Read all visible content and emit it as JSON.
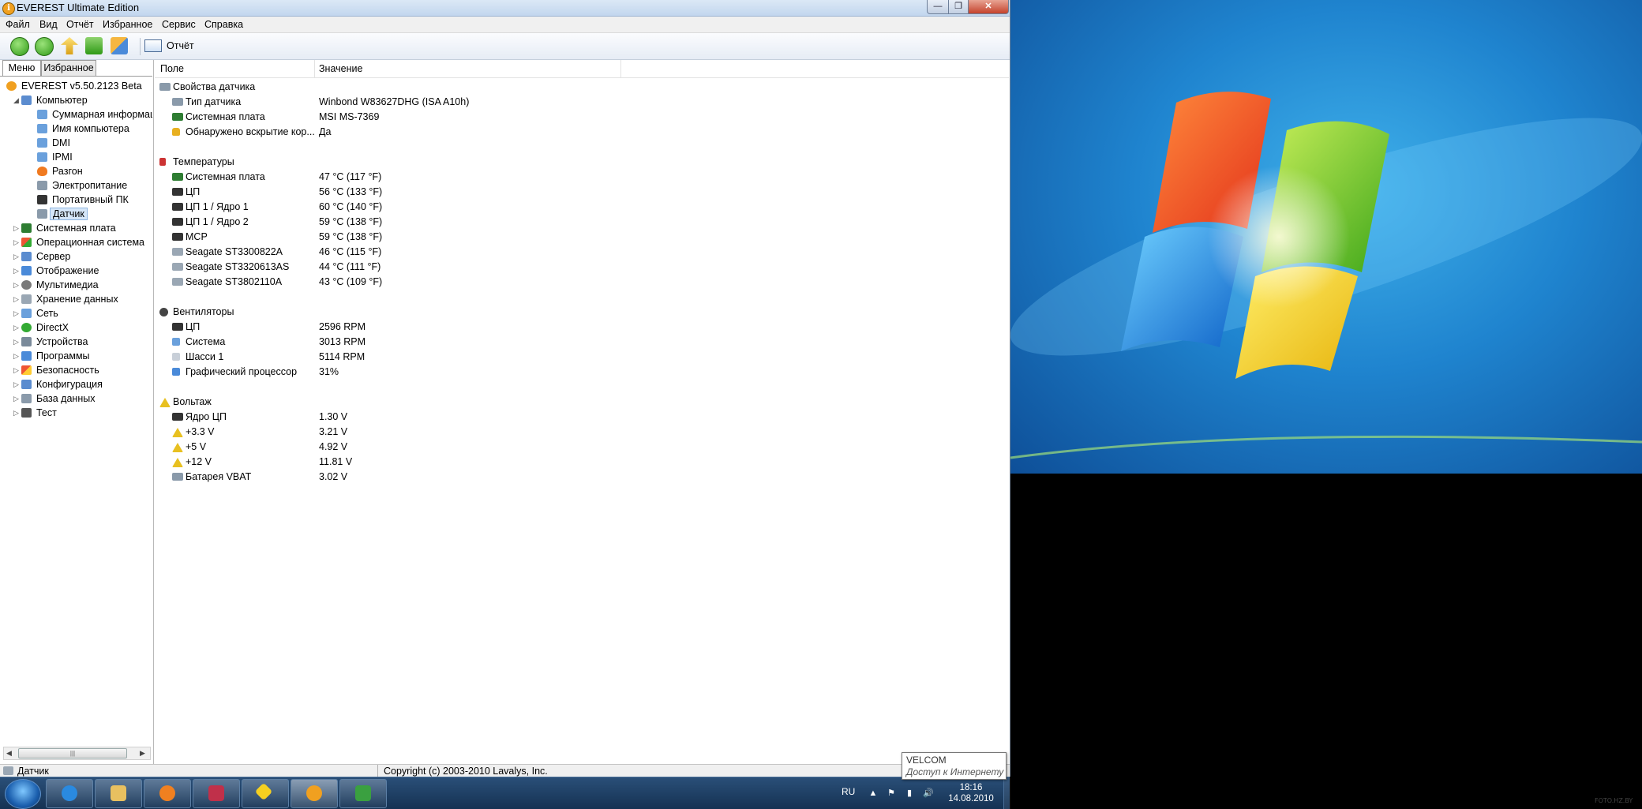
{
  "window": {
    "title": "EVEREST Ultimate Edition",
    "controls": {
      "minimize": "—",
      "maximize": "❐",
      "close": "✕"
    }
  },
  "menubar": [
    "Файл",
    "Вид",
    "Отчёт",
    "Избранное",
    "Сервис",
    "Справка"
  ],
  "toolbar": {
    "report_label": "Отчёт"
  },
  "left_panel": {
    "tabs": [
      "Меню",
      "Избранное"
    ],
    "tree": {
      "root": "EVEREST v5.50.2123 Beta",
      "computer": "Компьютер",
      "computer_children": [
        "Суммарная информация",
        "Имя компьютера",
        "DMI",
        "IPMI",
        "Разгон",
        "Электропитание",
        "Портативный ПК",
        "Датчик"
      ],
      "categories": [
        "Системная плата",
        "Операционная система",
        "Сервер",
        "Отображение",
        "Мультимедиа",
        "Хранение данных",
        "Сеть",
        "DirectX",
        "Устройства",
        "Программы",
        "Безопасность",
        "Конфигурация",
        "База данных",
        "Тест"
      ]
    },
    "scroll_thumb": "|||"
  },
  "table": {
    "headers": {
      "field": "Поле",
      "value": "Значение"
    },
    "groups": {
      "sensor_props": {
        "title": "Свойства датчика",
        "rows": [
          {
            "field": "Тип датчика",
            "value": "Winbond W83627DHG  (ISA A10h)"
          },
          {
            "field": "Системная плата",
            "value": "MSI MS-7369"
          },
          {
            "field": "Обнаружено вскрытие кор...",
            "value": "Да"
          }
        ]
      },
      "temperatures": {
        "title": "Температуры",
        "rows": [
          {
            "field": "Системная плата",
            "value": "47 °C  (117 °F)"
          },
          {
            "field": "ЦП",
            "value": "56 °C  (133 °F)"
          },
          {
            "field": "ЦП 1 / Ядро 1",
            "value": "60 °C  (140 °F)"
          },
          {
            "field": "ЦП 1 / Ядро 2",
            "value": "59 °C  (138 °F)"
          },
          {
            "field": "MCP",
            "value": "59 °C  (138 °F)"
          },
          {
            "field": "Seagate ST3300822A",
            "value": "46 °C  (115 °F)"
          },
          {
            "field": "Seagate ST3320613AS",
            "value": "44 °C  (111 °F)"
          },
          {
            "field": "Seagate ST3802110A",
            "value": "43 °C  (109 °F)"
          }
        ]
      },
      "fans": {
        "title": "Вентиляторы",
        "rows": [
          {
            "field": "ЦП",
            "value": "2596 RPM"
          },
          {
            "field": "Система",
            "value": "3013 RPM"
          },
          {
            "field": "Шасси 1",
            "value": "5114 RPM"
          },
          {
            "field": "Графический процессор",
            "value": "31%"
          }
        ]
      },
      "voltage": {
        "title": "Вольтаж",
        "rows": [
          {
            "field": "Ядро ЦП",
            "value": "1.30 V"
          },
          {
            "field": "+3.3 V",
            "value": "3.21 V"
          },
          {
            "field": "+5 V",
            "value": "4.92 V"
          },
          {
            "field": "+12 V",
            "value": "11.81 V"
          },
          {
            "field": "Батарея VBAT",
            "value": "3.02 V"
          }
        ]
      }
    }
  },
  "statusbar": {
    "left": "Датчик",
    "right": "Copyright (c) 2003-2010 Lavalys, Inc."
  },
  "tooltip": {
    "title": "VELCOM",
    "text": "Доступ к Интернету"
  },
  "taskbar": {
    "lang": "RU",
    "time": "18:16",
    "date": "14.08.2010",
    "tray_icons": [
      "▲",
      "⚑",
      "▮",
      "🔊"
    ]
  },
  "watermark": "FOTO.HZ.BY",
  "colors": {
    "accent": "#1f84cf",
    "taskbar": "#1c3d63",
    "selection": "#d5e6f8"
  }
}
